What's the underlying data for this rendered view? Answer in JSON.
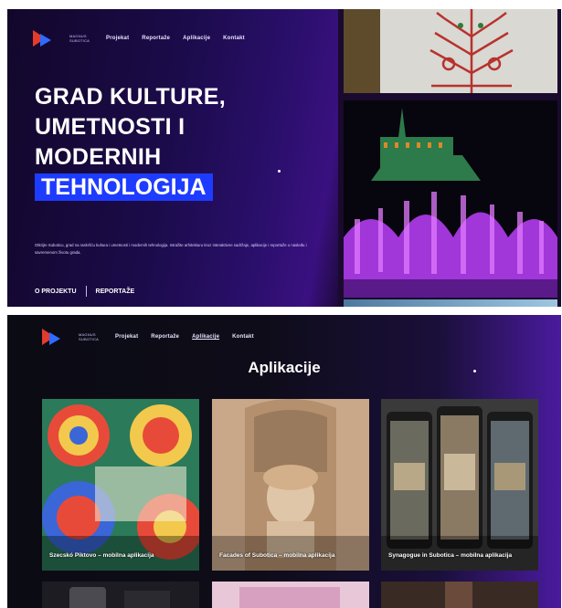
{
  "nav": {
    "logo_text": "MAGNUS SUBOTICA",
    "items": [
      {
        "label": "Projekat"
      },
      {
        "label": "Reportaže"
      },
      {
        "label": "Aplikacije"
      },
      {
        "label": "Kontakt"
      }
    ]
  },
  "hero": {
    "lines": [
      "GRAD KULTURE,",
      "UMETNOSTI I",
      "MODERNIH"
    ],
    "highlight": "TEHNOLOGIJA",
    "description": "Otkrijte Suboticu, grad na raskršću kultura i umetnosti i modernih tehnologija. Istražite arhitekturu kroz interaktivne sadržaje, aplikacije i reportaže o nasleđu i savremenom životu grada.",
    "link_project": "O PROJEKTU",
    "link_reports": "REPORTAŽE"
  },
  "apps": {
    "title": "Aplikacije",
    "cards": [
      {
        "label": "Szecskó Piktovo – mobilna aplikacija"
      },
      {
        "label": "Facades of Subotica – mobilna aplikacija"
      },
      {
        "label": "Synagogue in Subotica – mobilna aplikacija"
      }
    ]
  },
  "colors": {
    "accent": "#1e3cff",
    "hero_bg": "#1b0b4a",
    "section_bg": "#0e0c18"
  }
}
